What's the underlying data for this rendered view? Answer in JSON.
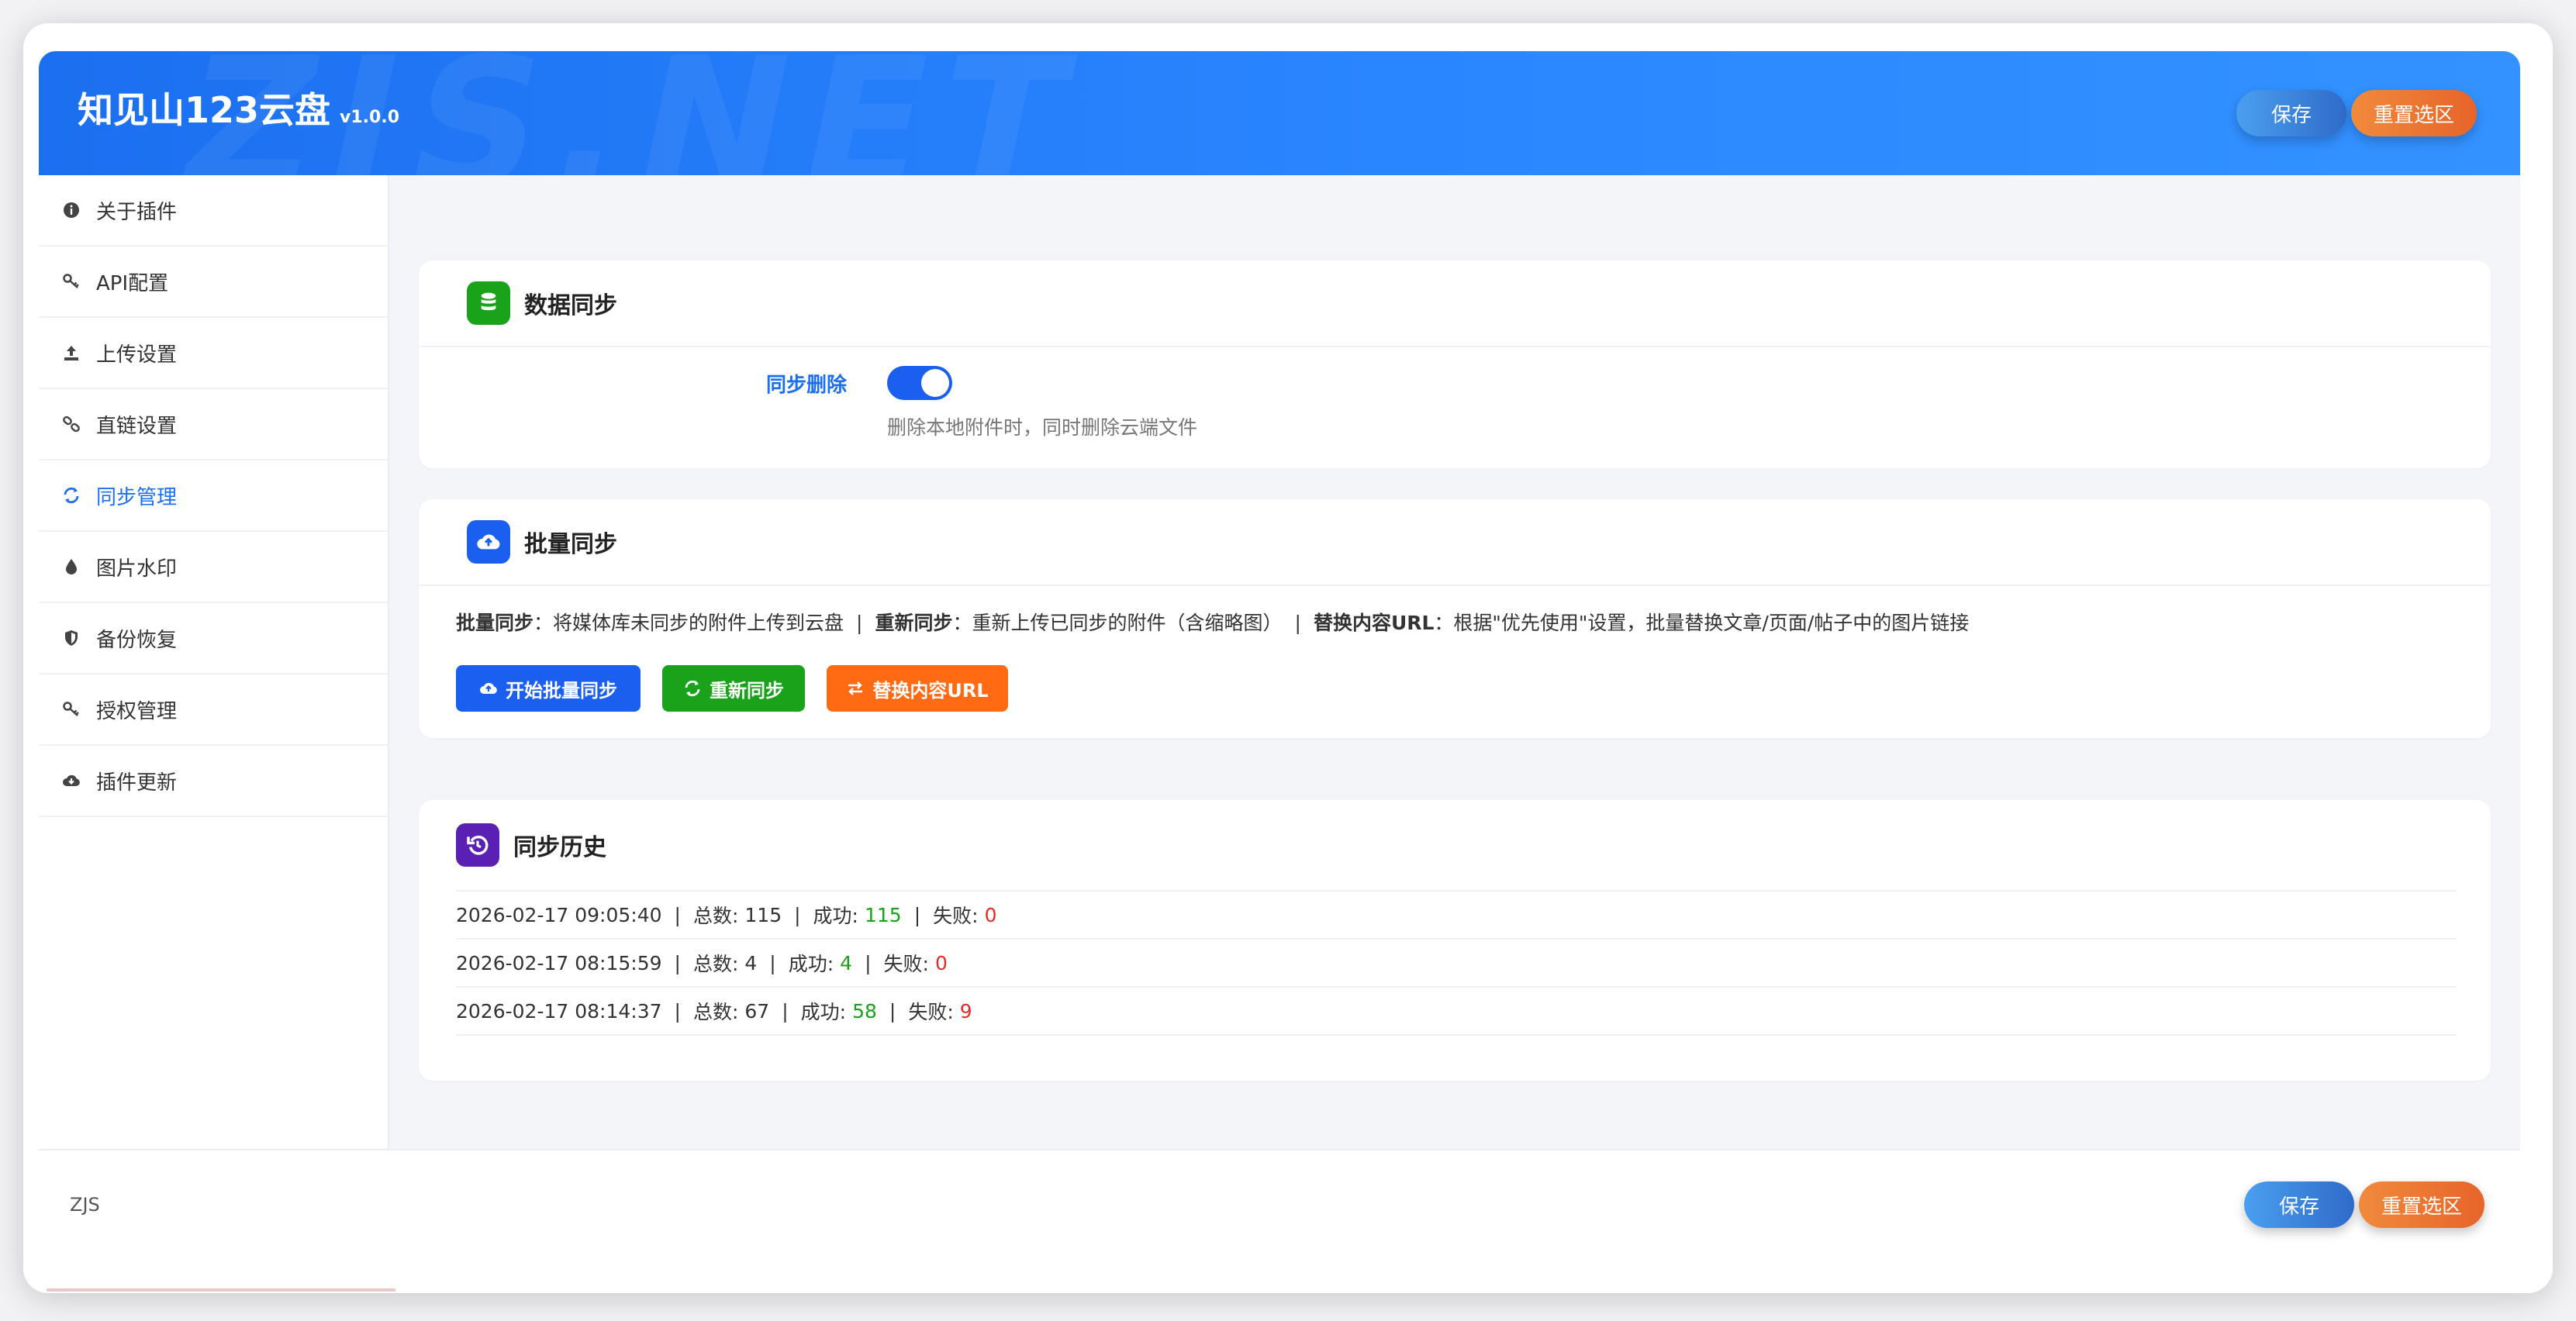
{
  "header": {
    "watermark": "ZJS.NET",
    "title": "知见山123云盘",
    "version": "v1.0.0",
    "save_label": "保存",
    "reset_label": "重置选区"
  },
  "sidebar": {
    "items": [
      {
        "label": "关于插件",
        "icon": "info-icon"
      },
      {
        "label": "API配置",
        "icon": "key-icon"
      },
      {
        "label": "上传设置",
        "icon": "upload-icon"
      },
      {
        "label": "直链设置",
        "icon": "link-icon"
      },
      {
        "label": "同步管理",
        "icon": "sync-icon",
        "active": true
      },
      {
        "label": "图片水印",
        "icon": "drop-icon"
      },
      {
        "label": "备份恢复",
        "icon": "shield-icon"
      },
      {
        "label": "授权管理",
        "icon": "key-icon"
      },
      {
        "label": "插件更新",
        "icon": "cloud-download-icon"
      }
    ]
  },
  "data_sync": {
    "title": "数据同步",
    "icon": "database-icon",
    "sync_delete_label": "同步删除",
    "sync_delete_enabled": true,
    "sync_delete_hint": "删除本地附件时，同时删除云端文件"
  },
  "batch_sync": {
    "title": "批量同步",
    "icon": "cloud-upload-icon",
    "desc": {
      "batch_title": "批量同步",
      "batch_text": "：将媒体库未同步的附件上传到云盘",
      "resync_title": "重新同步",
      "resync_text": "：重新上传已同步的附件（含缩略图）",
      "replace_title": "替换内容URL",
      "replace_text": "：根据\"优先使用\"设置，批量替换文章/页面/帖子中的图片链接"
    },
    "buttons": {
      "start": "开始批量同步",
      "resync": "重新同步",
      "replace": "替换内容URL"
    }
  },
  "history": {
    "title": "同步历史",
    "icon": "history-icon",
    "total_label": "总数: ",
    "success_label": "成功: ",
    "fail_label": "失败: ",
    "rows": [
      {
        "time": "2026-02-17 09:05:40",
        "total": "115",
        "success": "115",
        "fail": "0"
      },
      {
        "time": "2026-02-17 08:15:59",
        "total": "4",
        "success": "4",
        "fail": "0"
      },
      {
        "time": "2026-02-17 08:14:37",
        "total": "67",
        "success": "58",
        "fail": "9"
      }
    ]
  },
  "footer": {
    "label": "ZJS",
    "save_label": "保存",
    "reset_label": "重置选区"
  },
  "colors": {
    "accent": "#1b6ff0",
    "green_button": "#1aa31a",
    "orange_button": "#ff6a13",
    "purple_icon": "#5a1fb3"
  }
}
